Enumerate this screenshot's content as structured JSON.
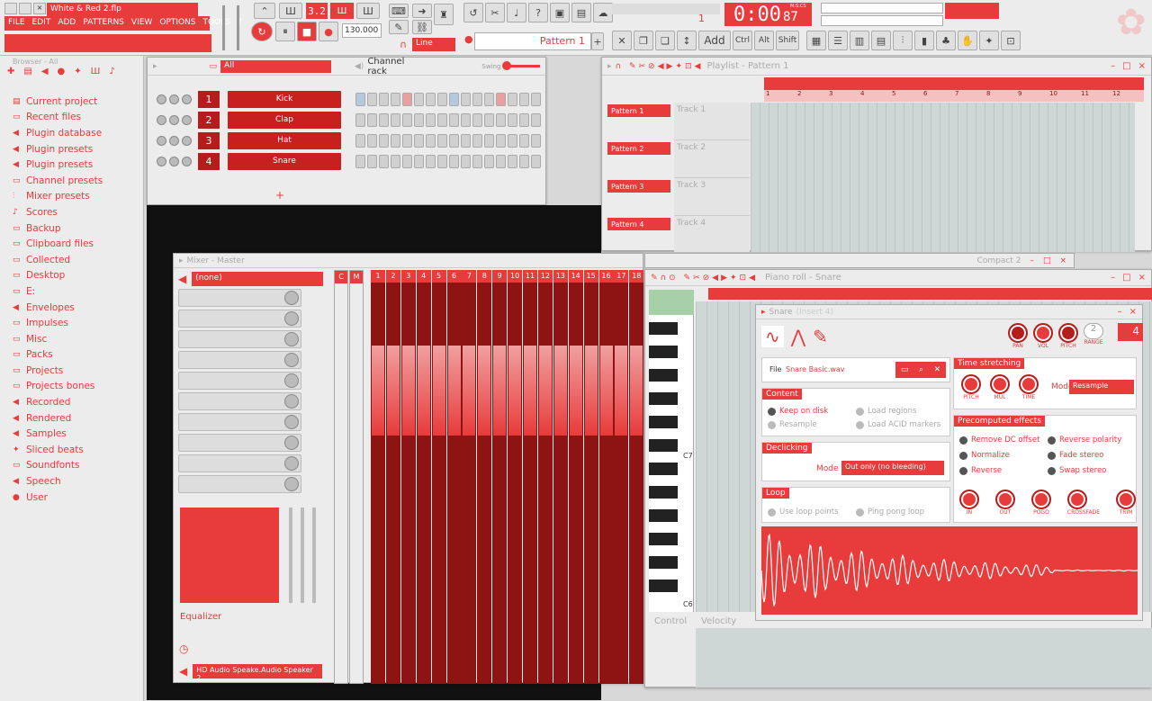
{
  "title": "White & Red 2.flp",
  "menu": [
    "FILE",
    "EDIT",
    "ADD",
    "PATTERNS",
    "VIEW",
    "OPTIONS",
    "TOOLS",
    "?"
  ],
  "transport": {
    "tempo": "130.000",
    "time": "0:00",
    "time_ms": "87",
    "time_unit": "M:S:CS",
    "beats": "3.2",
    "pattern": "Pattern 1",
    "snap": "Line",
    "cpu": "1"
  },
  "toolbar": {
    "add": "Add",
    "ctrl": "Ctrl",
    "alt": "Alt",
    "shift": "Shift"
  },
  "browser": {
    "header": "Browser - All",
    "items": [
      "Current project",
      "Recent files",
      "Plugin database",
      "Plugin presets",
      "Plugin presets",
      "Channel presets",
      "Mixer presets",
      "Scores",
      "Backup",
      "Clipboard files",
      "Collected",
      "Desktop",
      "E:",
      "Envelopes",
      "Impulses",
      "Misc",
      "Packs",
      "Projects",
      "Projects bones",
      "Recorded",
      "Rendered",
      "Samples",
      "Sliced beats",
      "Soundfonts",
      "Speech",
      "User"
    ]
  },
  "channel_rack": {
    "title": "Channel rack",
    "filter": "All",
    "swing": "Swing",
    "channels": [
      {
        "num": "1",
        "name": "Kick"
      },
      {
        "num": "2",
        "name": "Clap"
      },
      {
        "num": "3",
        "name": "Hat"
      },
      {
        "num": "4",
        "name": "Snare"
      }
    ]
  },
  "playlist": {
    "title": "Playlist - Pattern 1",
    "patterns": [
      "Pattern 1",
      "Pattern 2",
      "Pattern 3",
      "Pattern 4"
    ],
    "tracks": [
      "Track 1",
      "Track 2",
      "Track 3",
      "Track 4"
    ],
    "ruler": [
      "1",
      "2",
      "3",
      "4",
      "5",
      "6",
      "7",
      "8",
      "9",
      "10",
      "11",
      "12"
    ]
  },
  "mixer": {
    "title": "Mixer - Master",
    "input": "(none)",
    "eq": "Equalizer",
    "output": "HD Audio Speake.Audio Speaker 2",
    "headers": [
      "C",
      "M",
      "1",
      "2",
      "3",
      "4",
      "5",
      "6",
      "7",
      "8",
      "9",
      "10",
      "11",
      "12",
      "13",
      "14",
      "15",
      "16",
      "17",
      "18"
    ]
  },
  "piano_roll": {
    "title": "Piano roll - Snare",
    "compact": "Compact 2",
    "c7": "C7",
    "c6": "C6",
    "control": "Control",
    "velocity": "Velocity"
  },
  "sampler": {
    "title": "Snare",
    "insert": "(Insert 4)",
    "file_label": "File",
    "file": "Snare Basic.wav",
    "pan": "PAN",
    "vol": "VOL",
    "pitch": "PITCH",
    "range": "RANGE",
    "range_val": "2",
    "channel": "4",
    "content": "Content",
    "keep": "Keep on disk",
    "resample": "Resample",
    "load_regions": "Load regions",
    "load_acid": "Load ACID markers",
    "declicking": "Declicking",
    "mode_label": "Mode",
    "declick_mode": "Out only (no bleeding)",
    "loop": "Loop",
    "use_loop": "Use loop points",
    "pingpong": "Ping pong loop",
    "time_stretch": "Time stretching",
    "ts_pitch": "PITCH",
    "ts_mul": "MUL",
    "ts_time": "TIME",
    "ts_mode": "Resample",
    "precomputed": "Precomputed effects",
    "remove_dc": "Remove DC offset",
    "normalize": "Normalize",
    "reverse": "Reverse",
    "rev_pol": "Reverse polarity",
    "fade_stereo": "Fade stereo",
    "swap_stereo": "Swap stereo",
    "k_in": "IN",
    "k_out": "OUT",
    "k_pogo": "POGO",
    "k_crossfade": "CROSSFADE",
    "k_trim": "TRIM"
  },
  "colors": {
    "accent": "#e83b3b",
    "dark": "#8e1414"
  }
}
